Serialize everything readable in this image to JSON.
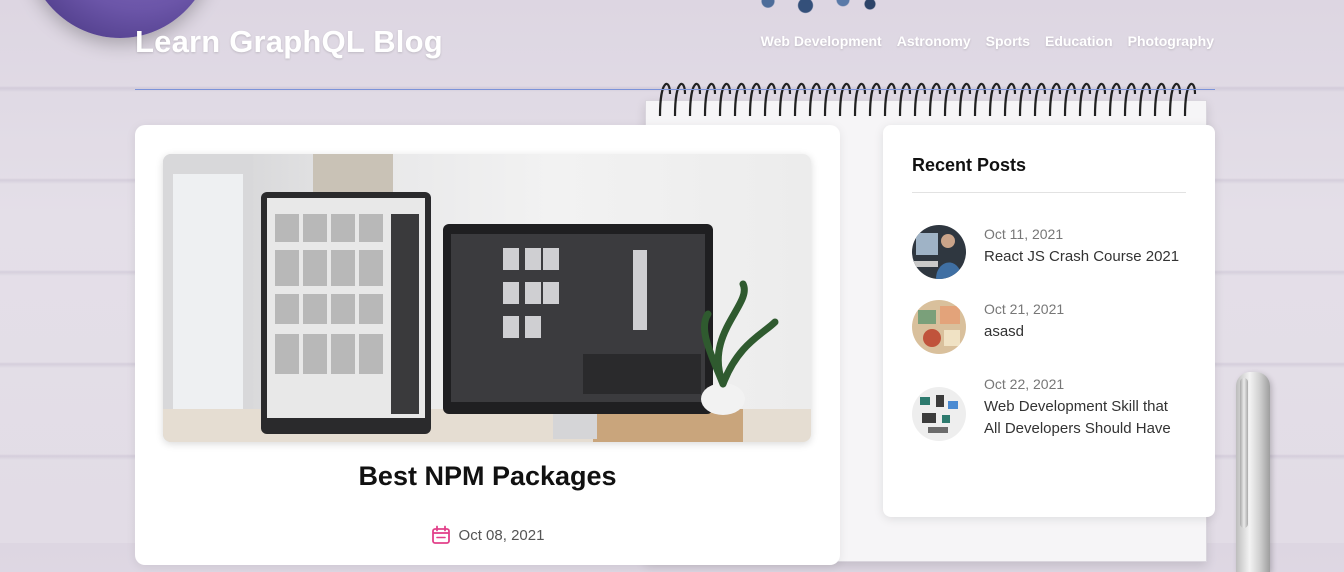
{
  "site": {
    "title": "Learn GraphQL Blog"
  },
  "nav": {
    "items": [
      {
        "label": "Web Development"
      },
      {
        "label": "Astronomy"
      },
      {
        "label": "Sports"
      },
      {
        "label": "Education"
      },
      {
        "label": "Photography"
      }
    ]
  },
  "post": {
    "title": "Best NPM Packages",
    "date": "Oct 08, 2021",
    "date_icon": "calendar-icon",
    "image": "two-monitors-desk-photo"
  },
  "recent_posts": {
    "heading": "Recent Posts",
    "items": [
      {
        "date": "Oct 11, 2021",
        "title": "React JS Crash Course 2021",
        "thumb": "person-at-computer-photo"
      },
      {
        "date": "Oct 21, 2021",
        "title": "asasd",
        "thumb": "craft-desk-photo"
      },
      {
        "date": "Oct 22, 2021",
        "title": "Web Development Skill that All Developers Should Have",
        "thumb": "circuit-board-photo"
      }
    ]
  },
  "colors": {
    "accent_icon": "#e2408a",
    "header_rule": "#7b93d9",
    "background": "#e0dae5"
  }
}
